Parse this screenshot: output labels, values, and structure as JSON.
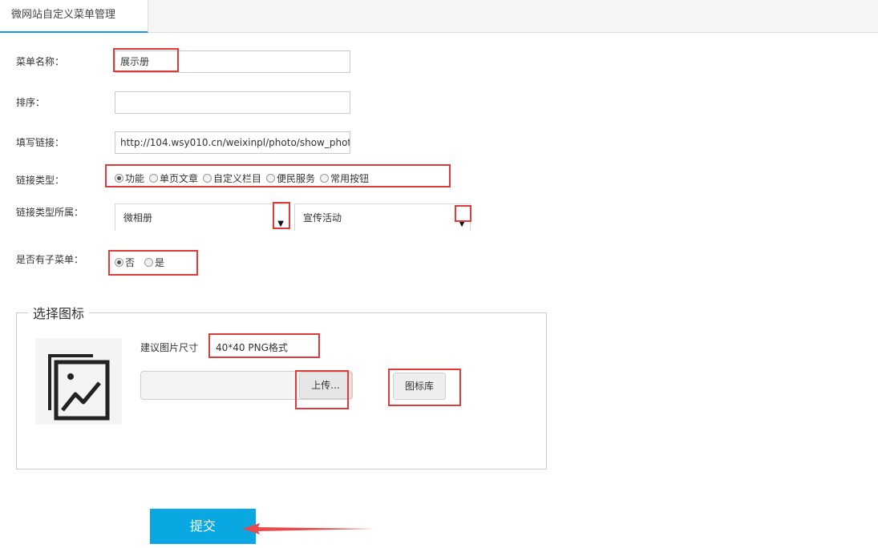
{
  "tab": {
    "label": "微网站自定义菜单管理"
  },
  "form": {
    "menu_name": {
      "label": "菜单名称：",
      "value": "展示册"
    },
    "sort": {
      "label": "排序：",
      "value": ""
    },
    "link": {
      "label": "填写链接：",
      "value": "http://104.wsy010.cn/weixinpl/photo/show_photo."
    },
    "link_type": {
      "label": "链接类型：",
      "options": [
        "功能",
        "单页文章",
        "自定义栏目",
        "便民服务",
        "常用按钮"
      ],
      "selected": "功能"
    },
    "link_owner": {
      "label": "链接类型所属：",
      "select1": "微相册",
      "select2": "宣传活动",
      "arrow": "▼"
    },
    "has_submenu": {
      "label": "是否有子菜单：",
      "options": [
        "否",
        "是"
      ],
      "selected": "否"
    }
  },
  "icon_section": {
    "legend": "选择图标",
    "size_label": "建议图片尺寸",
    "size_value": "40*40 PNG格式",
    "upload_label": "上传...",
    "library_label": "图标库"
  },
  "submit": {
    "label": "提交"
  },
  "colors": {
    "accent": "#09a8e2",
    "tab_underline": "#1a9bd7",
    "annotation": "#e03b3b"
  }
}
